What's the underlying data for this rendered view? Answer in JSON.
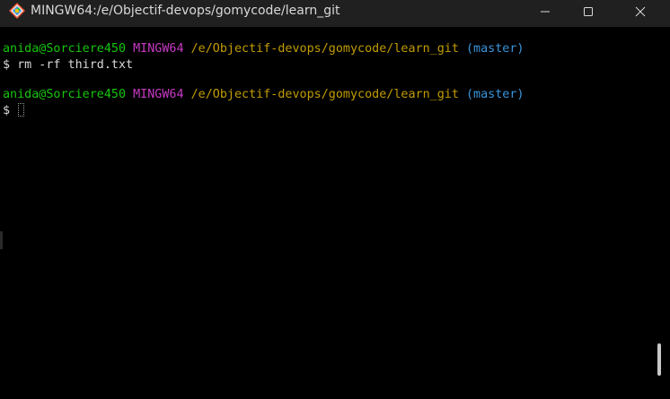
{
  "window": {
    "title": "MINGW64:/e/Objectif-devops/gomycode/learn_git"
  },
  "terminal": {
    "prompt_user_host": "anida@Sorciere450",
    "prompt_shell": "MINGW64",
    "prompt_path": "/e/Objectif-devops/gomycode/learn_git",
    "prompt_branch": "(master)",
    "prompt_symbol": "$",
    "command_1": "rm -rf third.txt"
  },
  "colors": {
    "user": "#16c60c",
    "shell": "#c839c5",
    "path": "#c19c00",
    "branch": "#3a96dd",
    "background": "#000000",
    "titlebar": "#202020"
  },
  "icons": {
    "app": "git-bash-icon",
    "minimize": "minimize-icon",
    "maximize": "maximize-icon",
    "close": "close-icon"
  }
}
